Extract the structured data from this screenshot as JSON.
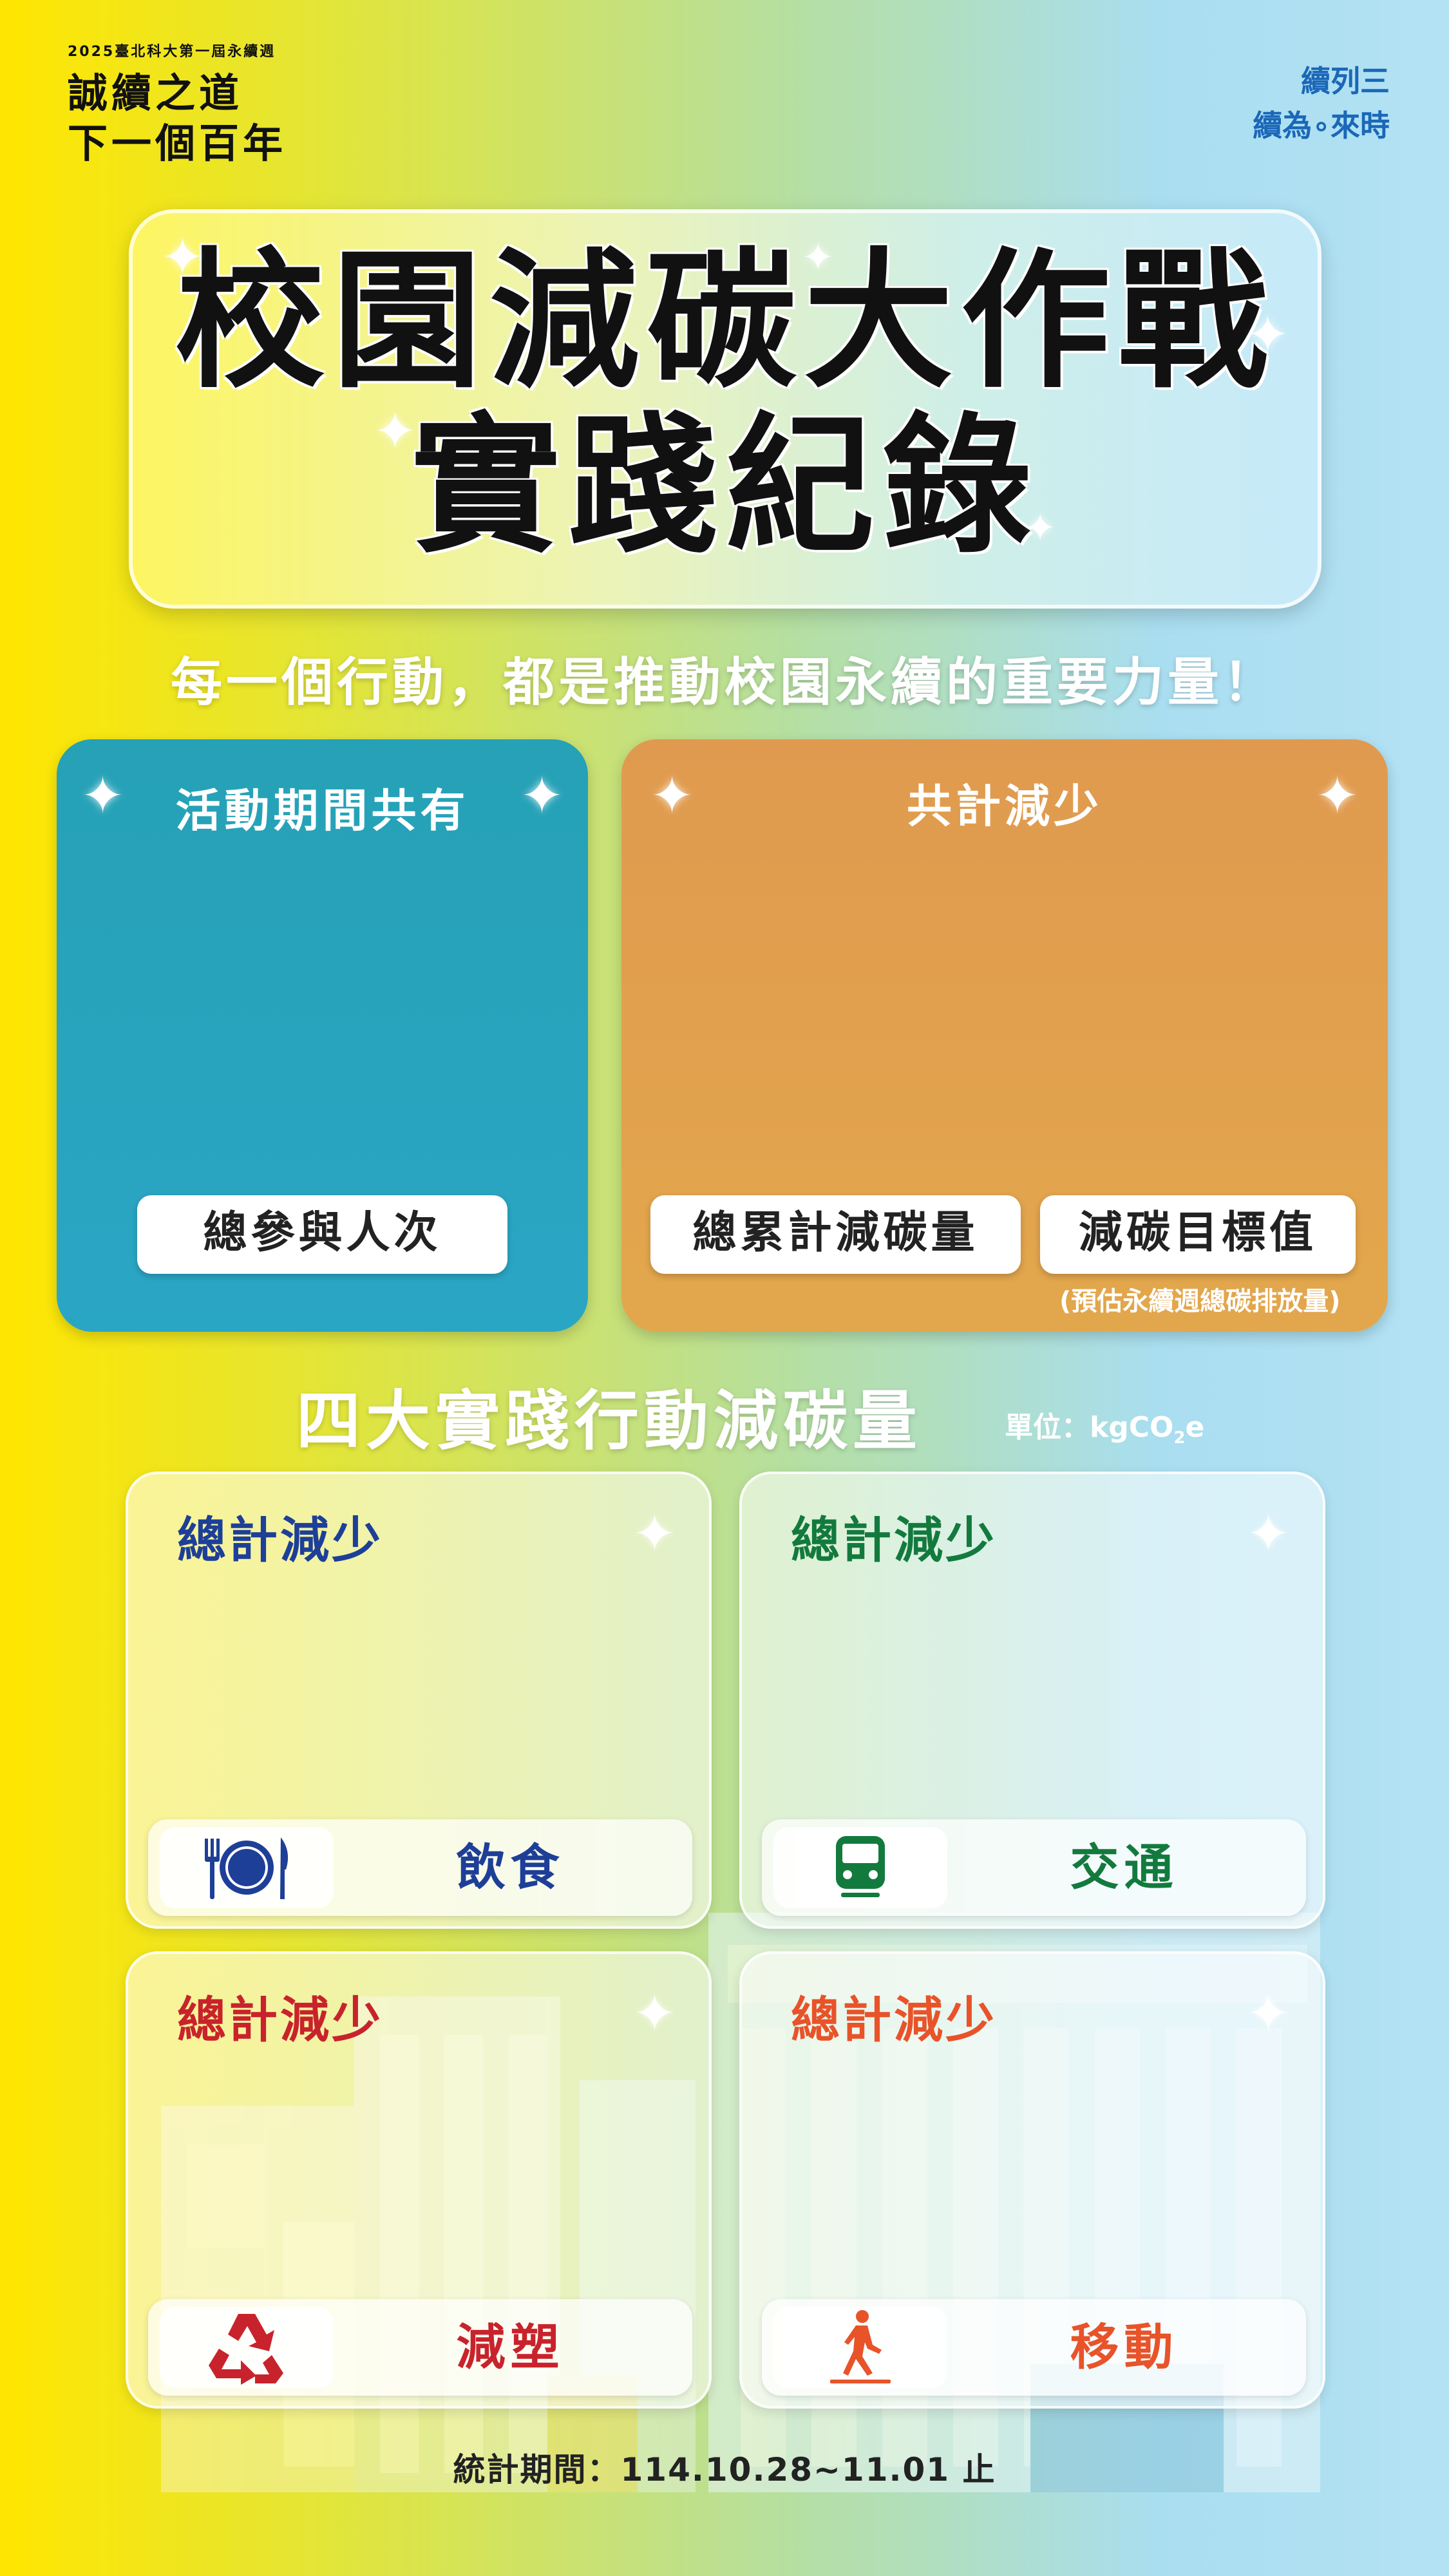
{
  "header": {
    "event_line": "2025臺北科大第一屆永續週",
    "brand_line1": "誠續之道",
    "brand_line2": "下一個百年",
    "series_line1": "續列三",
    "series_line2": "續為∘來時"
  },
  "title": {
    "line1": "校園減碳大作戰",
    "line2": "實踐紀錄"
  },
  "subtitle": "每一個行動，都是推動校園永續的重要力量！",
  "stats": {
    "participation": {
      "heading": "活動期間共有",
      "label": "總參與人次"
    },
    "reduction": {
      "heading": "共計減少",
      "total_label": "總累計減碳量",
      "target_label": "減碳目標值",
      "target_note": "(預估永續週總碳排放量)"
    }
  },
  "actions": {
    "heading": "四大實踐行動減碳量",
    "unit_prefix": "單位：kgCO",
    "unit_sub": "2",
    "unit_suffix": "e",
    "items": [
      {
        "heading": "總計減少",
        "label": "飲食",
        "icon": "dining-plate-icon",
        "color": "#1e3f98"
      },
      {
        "heading": "總計減少",
        "label": "交通",
        "icon": "train-icon",
        "color": "#137a3e"
      },
      {
        "heading": "總計減少",
        "label": "減塑",
        "icon": "recycle-icon",
        "color": "#c8232c"
      },
      {
        "heading": "總計減少",
        "label": "移動",
        "icon": "walking-icon",
        "color": "#e8532a"
      }
    ]
  },
  "footer": "統計期間：114.10.28~11.01 止"
}
